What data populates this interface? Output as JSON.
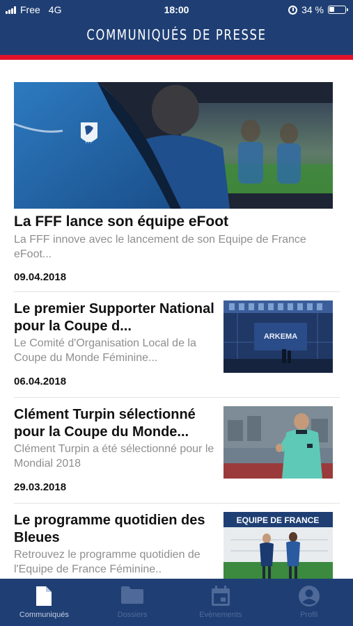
{
  "status": {
    "carrier": "Free",
    "network": "4G",
    "time": "18:00",
    "battery": "34 %",
    "battery_level": 0.34
  },
  "header": {
    "title": "COMMUNIQUÉS DE PRESSE"
  },
  "featured": {
    "title": "La FFF lance son équipe eFoot",
    "summary": "La FFF innove avec le lancement de son Equipe de France eFoot...",
    "date": "09.04.2018"
  },
  "articles": [
    {
      "title": "Le premier Supporter National pour la Coupe d...",
      "summary": "Le Comité d'Organisation Local de la Coupe du Monde Féminine...",
      "date": "06.04.2018",
      "image_text": "ARKEMA"
    },
    {
      "title": "Clément Turpin sélectionné pour la Coupe du Monde...",
      "summary": "Clément Turpin a été sélectionné pour le Mondial 2018",
      "date": "29.03.2018"
    },
    {
      "title": "Le programme quotidien des Bleues",
      "summary": "Retrouvez le programme quotidien de l'Equipe de France Féminine..",
      "image_text": "EQUIPE DE FRANCE"
    }
  ],
  "tabs": [
    {
      "label": "Communiqués",
      "icon": "document-icon",
      "active": true
    },
    {
      "label": "Dossiers",
      "icon": "folder-icon",
      "active": false
    },
    {
      "label": "Evènements",
      "icon": "calendar-icon",
      "active": false
    },
    {
      "label": "Profil",
      "icon": "profile-icon",
      "active": false
    }
  ],
  "colors": {
    "primary": "#1f3f74",
    "accent": "#e3112b",
    "muted_text": "#8e8e8e"
  }
}
